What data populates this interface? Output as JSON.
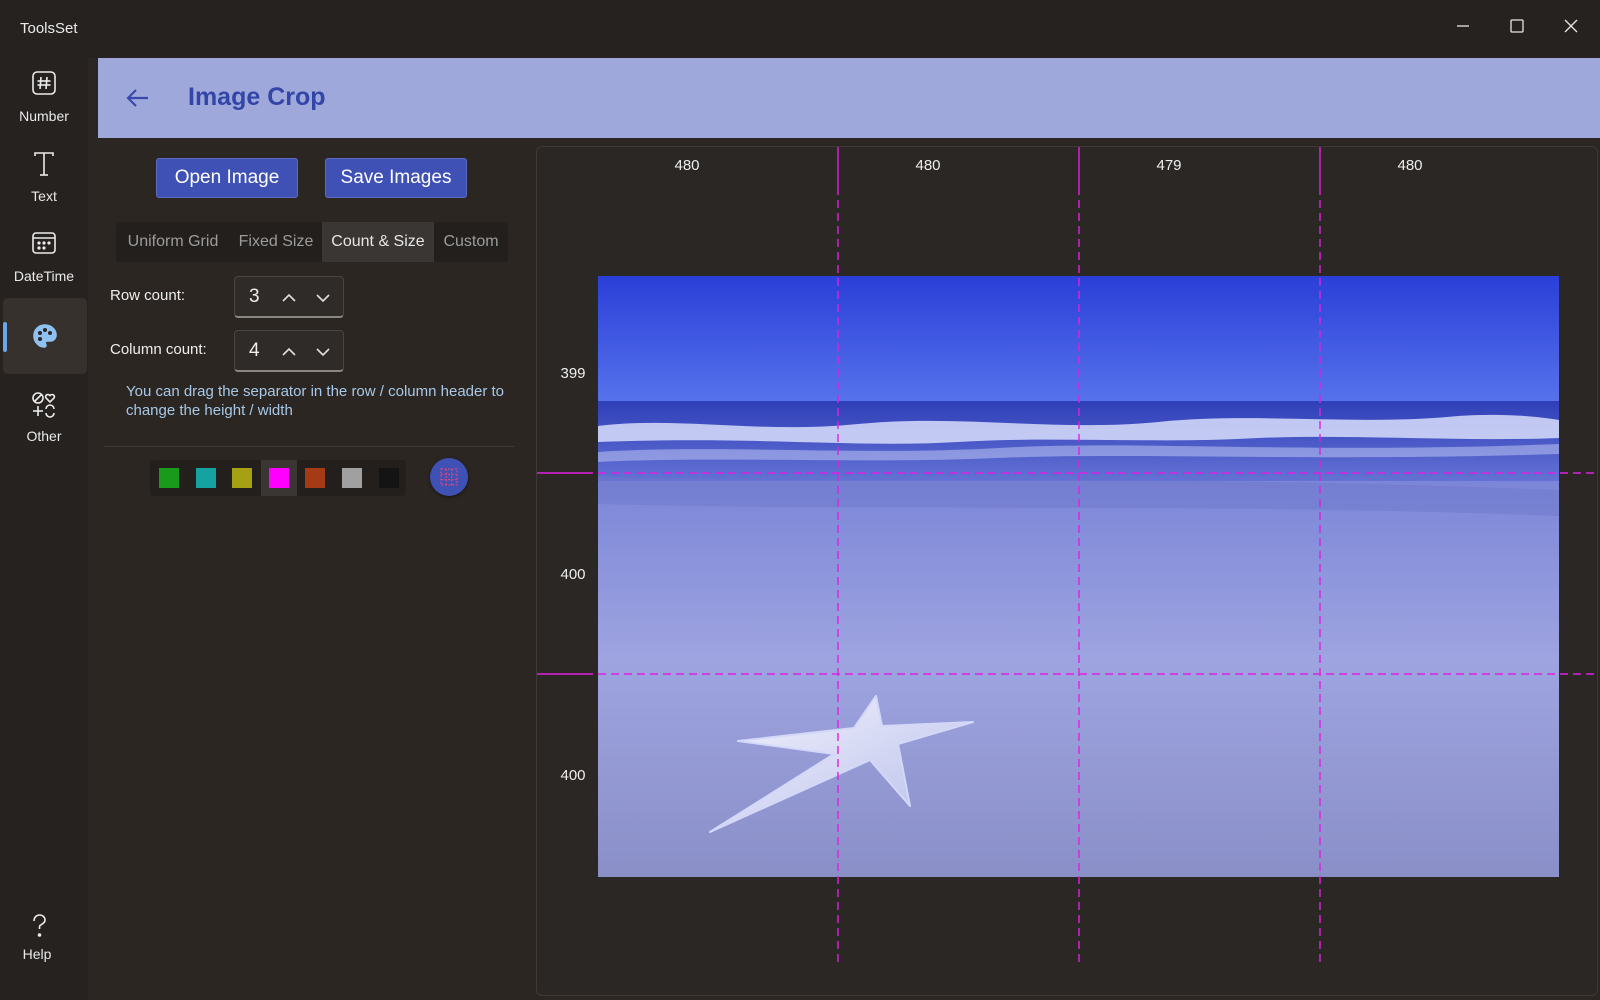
{
  "app": {
    "title": "ToolsSet"
  },
  "nav": {
    "items": [
      {
        "label": "Number",
        "icon": "hash-icon"
      },
      {
        "label": "Text",
        "icon": "text-t-icon"
      },
      {
        "label": "DateTime",
        "icon": "calendar-icon"
      },
      {
        "label": "",
        "icon": "palette-icon",
        "selected": true
      },
      {
        "label": "Other",
        "icon": "shapes-icon"
      }
    ],
    "help_label": "Help",
    "help_icon": "question-icon"
  },
  "header": {
    "title": "Image Crop"
  },
  "actions": {
    "open_label": "Open Image",
    "save_label": "Save Images"
  },
  "tabs": [
    {
      "label": "Uniform Grid",
      "active": false
    },
    {
      "label": "Fixed Size",
      "active": false
    },
    {
      "label": "Count & Size",
      "active": true
    },
    {
      "label": "Custom",
      "active": false
    }
  ],
  "fields": {
    "row_label": "Row count:",
    "row_value": "3",
    "col_label": "Column count:",
    "col_value": "4"
  },
  "hint": "You can drag the separator in the row / column header to change the height / width",
  "colors": {
    "swatches": [
      "#1a9a1a",
      "#14a3a0",
      "#a5a014",
      "#ff00ff",
      "#a63a14",
      "#a0a0a0",
      "#141414"
    ],
    "selected_index": 3,
    "separator": "#e020e0",
    "accent": "#3f51b5",
    "header_bg": "#9fa8da"
  },
  "grid": {
    "column_widths": [
      "480",
      "480",
      "479",
      "480"
    ],
    "row_heights": [
      "399",
      "400",
      "400"
    ]
  }
}
